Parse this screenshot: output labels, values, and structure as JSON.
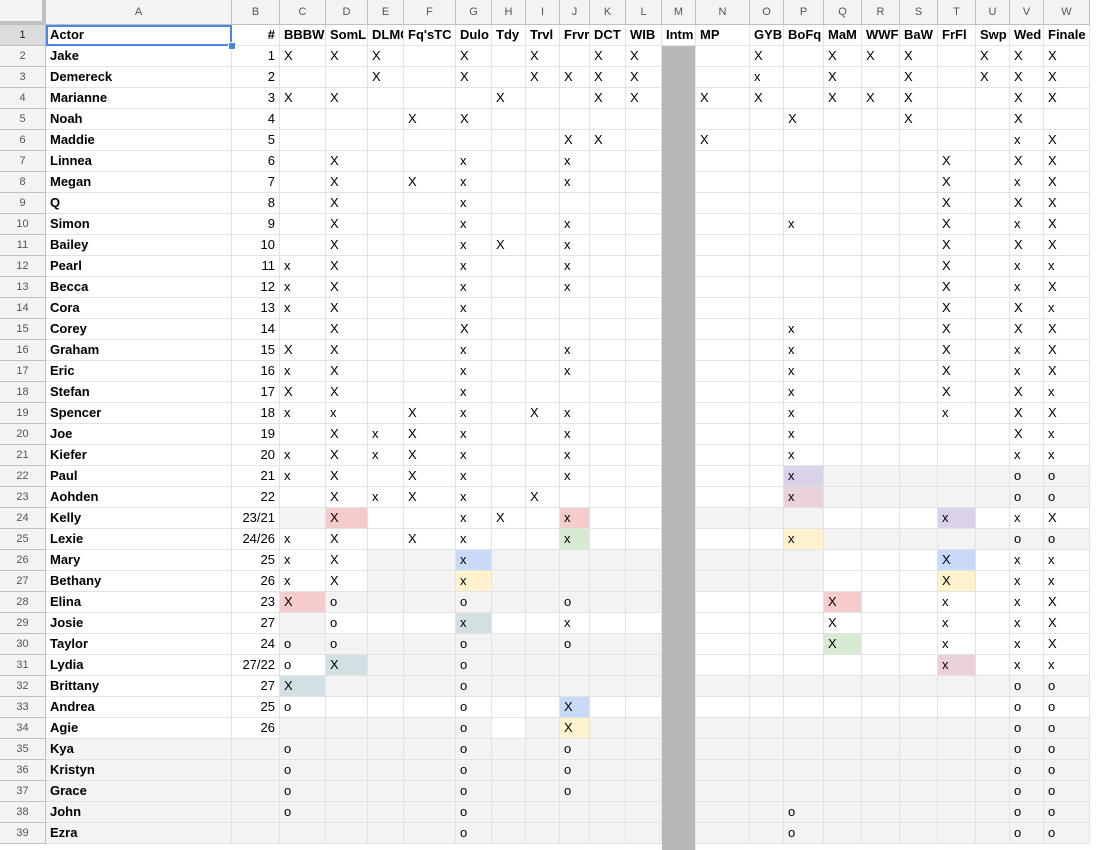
{
  "columns": [
    {
      "letter": "A",
      "header": "Actor"
    },
    {
      "letter": "B",
      "header": "#"
    },
    {
      "letter": "C",
      "header": "BBBW"
    },
    {
      "letter": "D",
      "header": "SomL"
    },
    {
      "letter": "E",
      "header": "DLMG"
    },
    {
      "letter": "F",
      "header": "Fq'sTC"
    },
    {
      "letter": "G",
      "header": "Dulo"
    },
    {
      "letter": "H",
      "header": "Tdy"
    },
    {
      "letter": "I",
      "header": "Trvl"
    },
    {
      "letter": "J",
      "header": "Frvr"
    },
    {
      "letter": "K",
      "header": "DCT"
    },
    {
      "letter": "L",
      "header": "WIB"
    },
    {
      "letter": "M",
      "header": "Intm"
    },
    {
      "letter": "N",
      "header": "MP"
    },
    {
      "letter": "O",
      "header": "GYB"
    },
    {
      "letter": "P",
      "header": "BoFq"
    },
    {
      "letter": "Q",
      "header": "MaM"
    },
    {
      "letter": "R",
      "header": "WWF"
    },
    {
      "letter": "S",
      "header": "BaW"
    },
    {
      "letter": "T",
      "header": "FrFl"
    },
    {
      "letter": "U",
      "header": "Swp"
    },
    {
      "letter": "V",
      "header": "Wed"
    },
    {
      "letter": "W",
      "header": "Finale"
    }
  ],
  "colors": {
    "grey": "#f3f3f3",
    "red": "#f4cccc",
    "blue": "#c9daf8",
    "yellow": "#fff2cc",
    "green": "#d9ead3",
    "purple": "#d9d2e9",
    "pink": "#ead1dc",
    "teal": "#d0e0e3",
    "intermission": "#b7b7b7",
    "selection": "#4a86e8"
  },
  "rows": [
    {
      "n": 2,
      "name": "Jake",
      "num": "1",
      "v": {
        "C": "X",
        "D": "X",
        "E": "X",
        "G": "X",
        "I": "X",
        "K": "X",
        "L": "X",
        "O": "X",
        "Q": "X",
        "R": "X",
        "S": "X",
        "U": "X",
        "V": "X",
        "W": "X"
      }
    },
    {
      "n": 3,
      "name": "Demereck",
      "num": "2",
      "v": {
        "E": "X",
        "G": "X",
        "I": "X",
        "J": "X",
        "K": "X",
        "L": "X",
        "O": "x",
        "Q": "X",
        "S": "X",
        "U": "X",
        "V": "X",
        "W": "X"
      }
    },
    {
      "n": 4,
      "name": "Marianne",
      "num": "3",
      "v": {
        "C": "X",
        "D": "X",
        "H": "X",
        "K": "X",
        "L": "X",
        "N": "X",
        "O": "X",
        "Q": "X",
        "R": "X",
        "S": "X",
        "V": "X",
        "W": "X"
      }
    },
    {
      "n": 5,
      "name": "Noah",
      "num": "4",
      "v": {
        "F": "X",
        "G": "X",
        "P": "X",
        "S": "X",
        "V": "X"
      }
    },
    {
      "n": 6,
      "name": "Maddie",
      "num": "5",
      "v": {
        "J": "X",
        "K": "X",
        "N": "X",
        "V": "x",
        "W": "X"
      }
    },
    {
      "n": 7,
      "name": "Linnea",
      "num": "6",
      "v": {
        "D": "X",
        "G": "x",
        "J": "x",
        "T": "X",
        "V": "X",
        "W": "X"
      }
    },
    {
      "n": 8,
      "name": "Megan",
      "num": "7",
      "v": {
        "D": "X",
        "F": "X",
        "G": "x",
        "J": "x",
        "T": "X",
        "V": "x",
        "W": "X"
      }
    },
    {
      "n": 9,
      "name": "Q",
      "num": "8",
      "v": {
        "D": "X",
        "G": "x",
        "T": "X",
        "V": "X",
        "W": "X"
      }
    },
    {
      "n": 10,
      "name": "Simon",
      "num": "9",
      "v": {
        "D": "X",
        "G": "x",
        "J": "x",
        "P": "x",
        "T": "X",
        "V": "x",
        "W": "X"
      }
    },
    {
      "n": 11,
      "name": "Bailey",
      "num": "10",
      "v": {
        "D": "X",
        "G": "x",
        "H": "X",
        "J": "x",
        "T": "X",
        "V": "X",
        "W": "X"
      }
    },
    {
      "n": 12,
      "name": "Pearl",
      "num": "11",
      "v": {
        "C": "x",
        "D": "X",
        "G": "x",
        "J": "x",
        "T": "X",
        "V": "x",
        "W": "x"
      }
    },
    {
      "n": 13,
      "name": "Becca",
      "num": "12",
      "v": {
        "C": "x",
        "D": "X",
        "G": "x",
        "J": "x",
        "T": "X",
        "V": "x",
        "W": "X"
      }
    },
    {
      "n": 14,
      "name": "Cora",
      "num": "13",
      "v": {
        "C": "x",
        "D": "X",
        "G": "x",
        "T": "X",
        "V": "X",
        "W": "x"
      }
    },
    {
      "n": 15,
      "name": "Corey",
      "num": "14",
      "v": {
        "D": "X",
        "G": "X",
        "P": "x",
        "T": "X",
        "V": "X",
        "W": "X"
      }
    },
    {
      "n": 16,
      "name": "Graham",
      "num": "15",
      "v": {
        "C": "X",
        "D": "X",
        "G": "x",
        "J": "x",
        "P": "x",
        "T": "X",
        "V": "x",
        "W": "X"
      }
    },
    {
      "n": 17,
      "name": "Eric",
      "num": "16",
      "v": {
        "C": "x",
        "D": "X",
        "G": "x",
        "J": "x",
        "P": "x",
        "T": "X",
        "V": "x",
        "W": "X"
      }
    },
    {
      "n": 18,
      "name": "Stefan",
      "num": "17",
      "v": {
        "C": "X",
        "D": "X",
        "G": "x",
        "P": "x",
        "T": "X",
        "V": "X",
        "W": "x"
      }
    },
    {
      "n": 19,
      "name": "Spencer",
      "num": "18",
      "v": {
        "C": "x",
        "D": "x",
        "F": "X",
        "G": "x",
        "I": "X",
        "J": "x",
        "P": "x",
        "T": "x",
        "V": "X",
        "W": "X"
      }
    },
    {
      "n": 20,
      "name": "Joe",
      "num": "19",
      "v": {
        "D": "X",
        "E": "x",
        "F": "X",
        "G": "x",
        "J": "x",
        "P": "x",
        "V": "X",
        "W": "x"
      }
    },
    {
      "n": 21,
      "name": "Kiefer",
      "num": "20",
      "v": {
        "C": "x",
        "D": "X",
        "E": "x",
        "F": "X",
        "G": "x",
        "J": "x",
        "P": "x",
        "V": "x",
        "W": "x"
      }
    },
    {
      "n": 22,
      "name": "Paul",
      "num": "21",
      "v": {
        "C": "x",
        "D": "X",
        "F": "X",
        "G": "x",
        "J": "x",
        "P": "x",
        "V": "o",
        "W": "o"
      },
      "bg": {
        "P": "purple",
        "Q": "grey",
        "R": "grey",
        "S": "grey",
        "T": "grey",
        "U": "grey",
        "V": "grey",
        "W": "grey"
      }
    },
    {
      "n": 23,
      "name": "Aohden",
      "num": "22",
      "v": {
        "D": "X",
        "E": "x",
        "F": "X",
        "G": "x",
        "I": "X",
        "P": "x",
        "V": "o",
        "W": "o"
      },
      "bg": {
        "P": "pink",
        "Q": "grey",
        "R": "grey",
        "S": "grey",
        "T": "grey",
        "U": "grey",
        "V": "grey",
        "W": "grey"
      }
    },
    {
      "n": 24,
      "name": "Kelly",
      "num": "23/21",
      "v": {
        "D": "X",
        "G": "x",
        "H": "X",
        "J": "x",
        "T": "x",
        "V": "x",
        "W": "X"
      },
      "bg": {
        "C": "grey",
        "D": "red",
        "J": "red",
        "N": "grey",
        "O": "grey",
        "P": "grey",
        "T": "purple"
      }
    },
    {
      "n": 25,
      "name": "Lexie",
      "num": "24/26",
      "v": {
        "C": "x",
        "D": "X",
        "F": "X",
        "G": "x",
        "J": "x",
        "P": "x",
        "V": "o",
        "W": "o"
      },
      "bg": {
        "J": "green",
        "P": "yellow",
        "Q": "grey",
        "R": "grey",
        "S": "grey",
        "T": "grey",
        "U": "grey",
        "V": "grey",
        "W": "grey"
      }
    },
    {
      "n": 26,
      "name": "Mary",
      "num": "25",
      "v": {
        "C": "x",
        "D": "X",
        "G": "x",
        "T": "X",
        "V": "x",
        "W": "x"
      },
      "bg": {
        "E": "grey",
        "F": "grey",
        "G": "blue",
        "H": "grey",
        "I": "grey",
        "J": "grey",
        "K": "grey",
        "L": "grey",
        "N": "grey",
        "O": "grey",
        "P": "grey",
        "T": "blue"
      }
    },
    {
      "n": 27,
      "name": "Bethany",
      "num": "26",
      "v": {
        "C": "x",
        "D": "X",
        "G": "x",
        "T": "X",
        "V": "x",
        "W": "x"
      },
      "bg": {
        "E": "grey",
        "F": "grey",
        "G": "yellow",
        "H": "grey",
        "I": "grey",
        "J": "grey",
        "K": "grey",
        "L": "grey",
        "N": "grey",
        "O": "grey",
        "P": "grey",
        "T": "yellow"
      }
    },
    {
      "n": 28,
      "name": "Elina",
      "num": "23",
      "v": {
        "C": "X",
        "D": "o",
        "G": "o",
        "J": "o",
        "Q": "X",
        "T": "x",
        "V": "x",
        "W": "X"
      },
      "bg": {
        "C": "red",
        "D": "grey",
        "E": "grey",
        "F": "grey",
        "G": "grey",
        "H": "grey",
        "I": "grey",
        "J": "grey",
        "K": "grey",
        "L": "grey",
        "Q": "red"
      }
    },
    {
      "n": 29,
      "name": "Josie",
      "num": "27",
      "v": {
        "D": "o",
        "G": "x",
        "J": "x",
        "Q": "X",
        "T": "x",
        "V": "x",
        "W": "X"
      },
      "bg": {
        "C": "grey",
        "G": "teal"
      }
    },
    {
      "n": 30,
      "name": "Taylor",
      "num": "24",
      "v": {
        "C": "o",
        "D": "o",
        "G": "o",
        "J": "o",
        "Q": "X",
        "T": "x",
        "V": "x",
        "W": "X"
      },
      "bg": {
        "C": "grey",
        "D": "grey",
        "E": "grey",
        "F": "grey",
        "G": "grey",
        "H": "grey",
        "I": "grey",
        "J": "grey",
        "K": "grey",
        "L": "grey",
        "Q": "green"
      }
    },
    {
      "n": 31,
      "name": "Lydia",
      "num": "27/22",
      "v": {
        "C": "o",
        "D": "X",
        "G": "o",
        "T": "x",
        "V": "x",
        "W": "x"
      },
      "bg": {
        "D": "teal",
        "E": "grey",
        "F": "grey",
        "G": "grey",
        "H": "grey",
        "I": "grey",
        "J": "grey",
        "K": "grey",
        "L": "grey",
        "T": "pink"
      }
    },
    {
      "n": 32,
      "name": "Brittany",
      "num": "27",
      "v": {
        "C": "X",
        "G": "o",
        "V": "o",
        "W": "o"
      },
      "bg": {
        "C": "teal",
        "D": "grey",
        "E": "grey",
        "F": "grey",
        "G": "grey",
        "H": "grey",
        "I": "grey",
        "J": "grey",
        "K": "grey",
        "L": "grey",
        "N": "grey",
        "O": "grey",
        "P": "grey",
        "Q": "grey",
        "R": "grey",
        "S": "grey",
        "T": "grey",
        "U": "grey",
        "V": "grey",
        "W": "grey"
      }
    },
    {
      "n": 33,
      "name": "Andrea",
      "num": "25",
      "v": {
        "C": "o",
        "G": "o",
        "J": "X",
        "V": "o",
        "W": "o"
      },
      "bg": {
        "J": "blue"
      }
    },
    {
      "n": 34,
      "name": "Agie",
      "num": "26",
      "v": {
        "G": "o",
        "J": "X",
        "V": "o",
        "W": "o"
      },
      "bg": {
        "C": "grey",
        "D": "grey",
        "E": "grey",
        "F": "grey",
        "G": "grey",
        "H": "white",
        "I": "grey",
        "J": "yellow",
        "K": "grey",
        "L": "grey",
        "N": "grey",
        "O": "grey",
        "P": "grey",
        "Q": "grey",
        "R": "grey",
        "S": "grey",
        "T": "grey",
        "U": "grey",
        "V": "grey",
        "W": "grey"
      }
    },
    {
      "n": 35,
      "name": "Kya",
      "num": "",
      "v": {
        "C": "o",
        "G": "o",
        "J": "o",
        "V": "o",
        "W": "o"
      },
      "bg": {
        "A": "grey",
        "B": "grey",
        "C": "grey",
        "D": "grey",
        "E": "grey",
        "F": "grey",
        "G": "grey",
        "H": "grey",
        "I": "grey",
        "J": "grey",
        "K": "grey",
        "L": "grey",
        "N": "grey",
        "O": "grey",
        "P": "grey",
        "Q": "grey",
        "R": "grey",
        "S": "grey",
        "T": "grey",
        "U": "grey",
        "V": "grey",
        "W": "grey"
      }
    },
    {
      "n": 36,
      "name": "Kristyn",
      "num": "",
      "v": {
        "C": "o",
        "G": "o",
        "J": "o",
        "V": "o",
        "W": "o"
      },
      "bg": {
        "A": "grey",
        "B": "grey",
        "C": "grey",
        "D": "grey",
        "E": "grey",
        "F": "grey",
        "G": "grey",
        "H": "grey",
        "I": "grey",
        "J": "grey",
        "K": "grey",
        "L": "grey",
        "N": "grey",
        "O": "grey",
        "P": "grey",
        "Q": "grey",
        "R": "grey",
        "S": "grey",
        "T": "grey",
        "U": "grey",
        "V": "grey",
        "W": "grey"
      }
    },
    {
      "n": 37,
      "name": "Grace",
      "num": "",
      "v": {
        "C": "o",
        "G": "o",
        "J": "o",
        "V": "o",
        "W": "o"
      },
      "bg": {
        "A": "grey",
        "B": "grey",
        "C": "grey",
        "D": "grey",
        "E": "grey",
        "F": "grey",
        "G": "grey",
        "H": "grey",
        "I": "grey",
        "J": "grey",
        "K": "grey",
        "L": "grey",
        "N": "grey",
        "O": "grey",
        "P": "grey",
        "Q": "grey",
        "R": "grey",
        "S": "grey",
        "T": "grey",
        "U": "grey",
        "V": "grey",
        "W": "grey"
      }
    },
    {
      "n": 38,
      "name": "John",
      "num": "",
      "v": {
        "C": "o",
        "G": "o",
        "P": "o",
        "V": "o",
        "W": "o"
      },
      "bg": {
        "A": "grey",
        "B": "grey",
        "C": "grey",
        "D": "grey",
        "E": "grey",
        "F": "grey",
        "G": "grey",
        "H": "grey",
        "I": "grey",
        "J": "grey",
        "K": "grey",
        "L": "grey",
        "N": "grey",
        "O": "grey",
        "P": "grey",
        "Q": "grey",
        "R": "grey",
        "S": "grey",
        "T": "grey",
        "U": "grey",
        "V": "grey",
        "W": "grey"
      }
    },
    {
      "n": 39,
      "name": "Ezra",
      "num": "",
      "v": {
        "G": "o",
        "P": "o",
        "V": "o",
        "W": "o"
      },
      "bg": {
        "A": "grey",
        "B": "grey",
        "C": "grey",
        "D": "grey",
        "E": "grey",
        "F": "grey",
        "G": "grey",
        "H": "grey",
        "I": "grey",
        "J": "grey",
        "K": "grey",
        "L": "grey",
        "N": "grey",
        "O": "grey",
        "P": "grey",
        "Q": "grey",
        "R": "grey",
        "S": "grey",
        "T": "grey",
        "U": "grey",
        "V": "grey",
        "W": "grey"
      }
    }
  ]
}
